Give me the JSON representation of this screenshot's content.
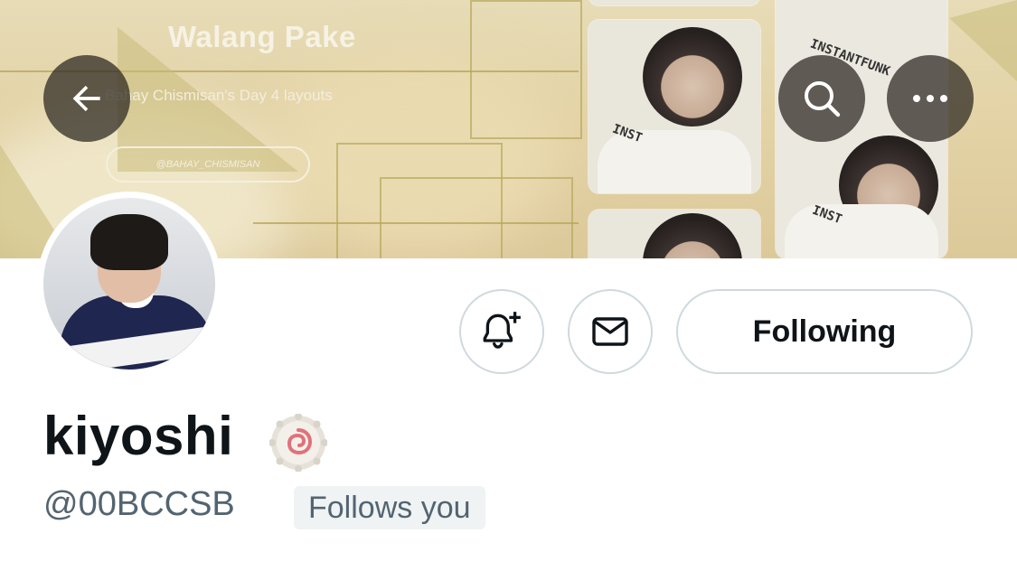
{
  "banner": {
    "title": "Walang Pake",
    "subtitle": "Bahay Chismisan's Day 4 layouts",
    "handle": "@BAHAY_CHISMISAN",
    "photo_print_1": "INSTANTFUNK",
    "photo_print_2": "INST"
  },
  "header": {
    "back_icon": "arrow-left-icon",
    "search_icon": "search-icon",
    "more_icon": "more-horizontal-icon"
  },
  "actions": {
    "notify_icon": "bell-plus-icon",
    "message_icon": "envelope-icon",
    "following_label": "Following"
  },
  "profile": {
    "display_name": "kiyoshi",
    "name_emoji": "narutomaki-emoji",
    "handle": "@00BCCSB",
    "follows_you": "Follows you"
  },
  "colors": {
    "text_primary": "#0f1419",
    "text_secondary": "#536471",
    "border": "#cfd9de",
    "badge_bg": "#eff3f4",
    "banner_tone": "#e3d3a6"
  }
}
